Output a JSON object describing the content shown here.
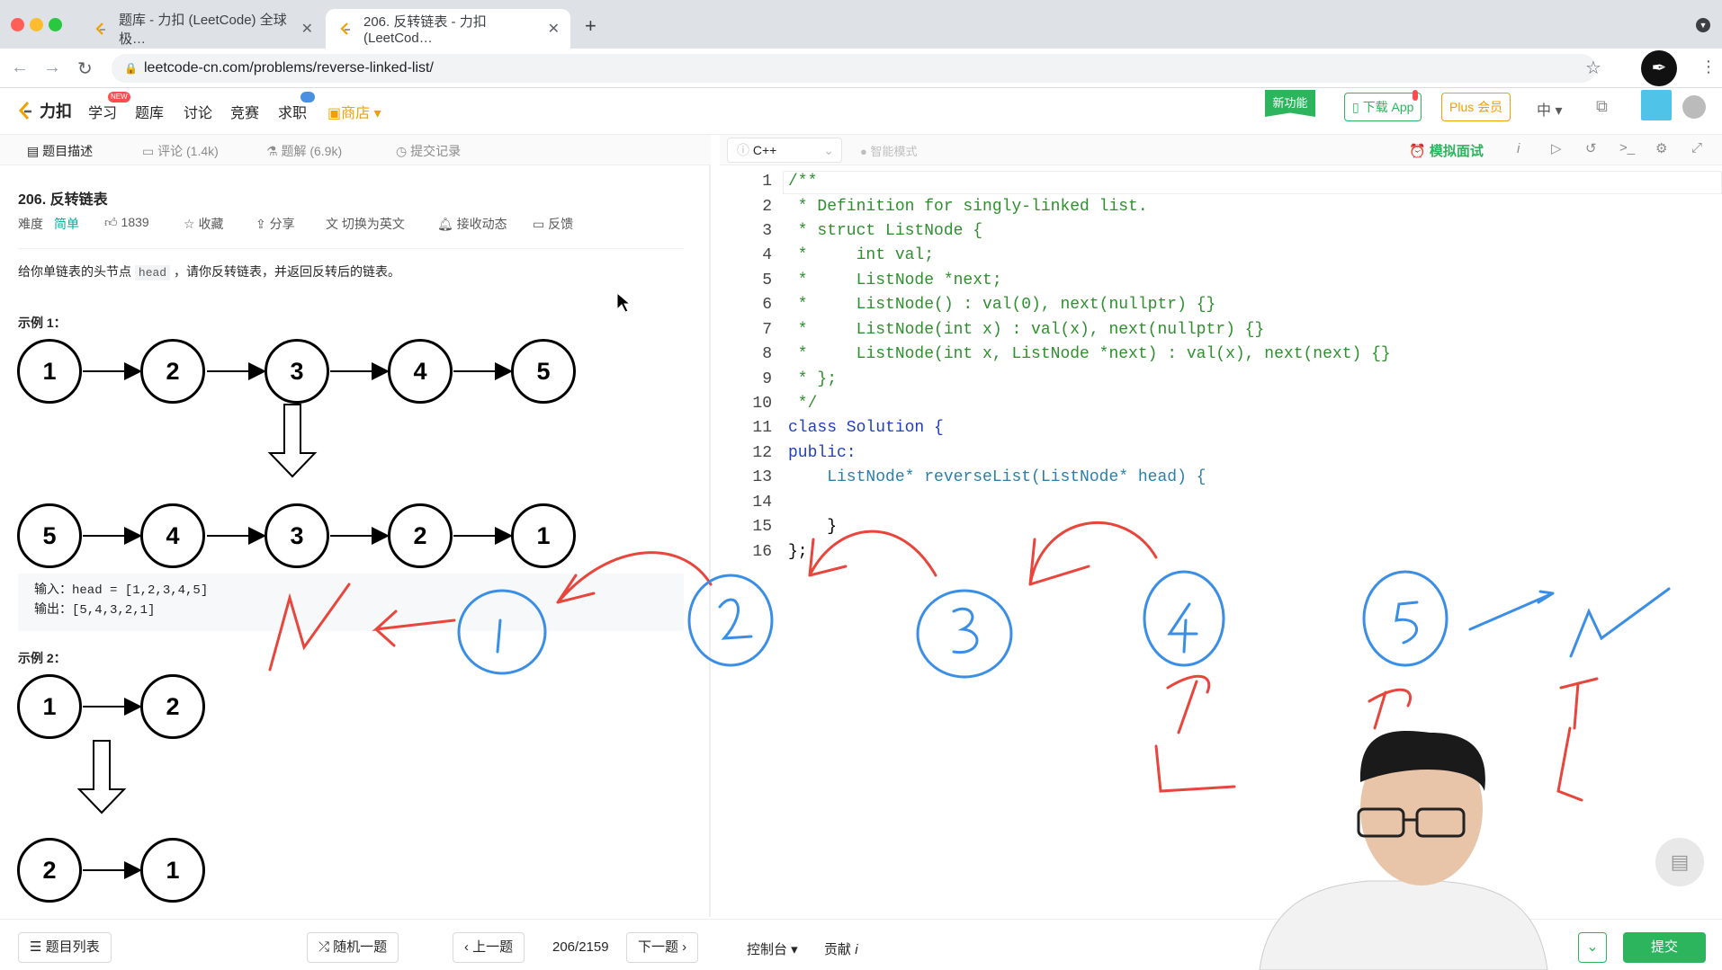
{
  "browser": {
    "tabs": [
      {
        "title": "题库 - 力扣 (LeetCode) 全球极…"
      },
      {
        "title": "206. 反转链表 - 力扣 (LeetCod…"
      }
    ],
    "url": "leetcode-cn.com/problems/reverse-linked-list/"
  },
  "header": {
    "logo": "力扣",
    "nav": [
      "学习",
      "题库",
      "讨论",
      "竞赛",
      "求职",
      "商店"
    ],
    "new_badge": "NEW",
    "new_feature": "新功能",
    "download_app": "下载 App",
    "plus": "Plus 会员",
    "lang": "中"
  },
  "left": {
    "tabs": [
      "题目描述",
      "评论 (1.4k)",
      "题解 (6.9k)",
      "提交记录"
    ],
    "title": "206. 反转链表",
    "difficulty_label": "难度",
    "difficulty": "简单",
    "likes": "1839",
    "actions": [
      "收藏",
      "分享",
      "切换为英文",
      "接收动态",
      "反馈"
    ],
    "desc_pre": "给你单链表的头节点",
    "desc_code": "head",
    "desc_post": "，请你反转链表，并返回反转后的链表。",
    "example1_title": "示例 1：",
    "example1_top": [
      "1",
      "2",
      "3",
      "4",
      "5"
    ],
    "example1_bottom": [
      "5",
      "4",
      "3",
      "2",
      "1"
    ],
    "example1_input": "输入：head = [1,2,3,4,5]",
    "example1_output": "输出：[5,4,3,2,1]",
    "example2_title": "示例 2：",
    "example2_top": [
      "1",
      "2"
    ],
    "example2_bottom": [
      "2",
      "1"
    ]
  },
  "editor": {
    "language": "C++",
    "smart_mode": "智能模式",
    "mock_interview": "模拟面试",
    "lines": [
      "/**",
      " * Definition for singly-linked list.",
      " * struct ListNode {",
      " *     int val;",
      " *     ListNode *next;",
      " *     ListNode() : val(0), next(nullptr) {}",
      " *     ListNode(int x) : val(x), next(nullptr) {}",
      " *     ListNode(int x, ListNode *next) : val(x), next(next) {}",
      " * };",
      " */",
      "class Solution {",
      "public:",
      "    ListNode* reverseList(ListNode* head) {",
      "",
      "    }",
      "};"
    ]
  },
  "bottom": {
    "problem_list": "题目列表",
    "random": "随机一题",
    "prev": "上一题",
    "counter": "206/2159",
    "next": "下一题",
    "console": "控制台",
    "contribute": "贡献",
    "submit": "提交"
  },
  "colors": {
    "accent_green": "#2db55d",
    "annotation_red": "#e8453c",
    "annotation_blue": "#3a8ee6",
    "difficulty_green": "#00af9b"
  }
}
